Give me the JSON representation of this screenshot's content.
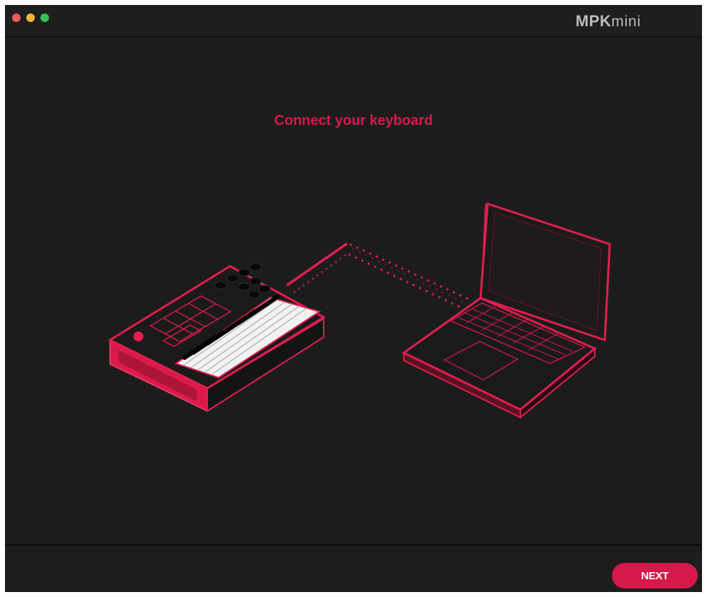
{
  "window": {
    "controls": [
      {
        "name": "close",
        "color": "#ee5b56"
      },
      {
        "name": "minimize",
        "color": "#f5b637"
      },
      {
        "name": "zoom",
        "color": "#35c25a"
      }
    ]
  },
  "header": {
    "logo_bold": "MPK",
    "logo_thin": "mini"
  },
  "main": {
    "heading": "Connect your keyboard",
    "illustration": {
      "left_device_icon": "midi-keyboard-icon",
      "right_device_icon": "laptop-icon",
      "connection_icon": "usb-cable-icon"
    }
  },
  "footer": {
    "next_label": "NEXT"
  },
  "colors": {
    "accent": "#d6184a",
    "background": "#1c1c1c",
    "titlebar": "#1e1e1e"
  }
}
